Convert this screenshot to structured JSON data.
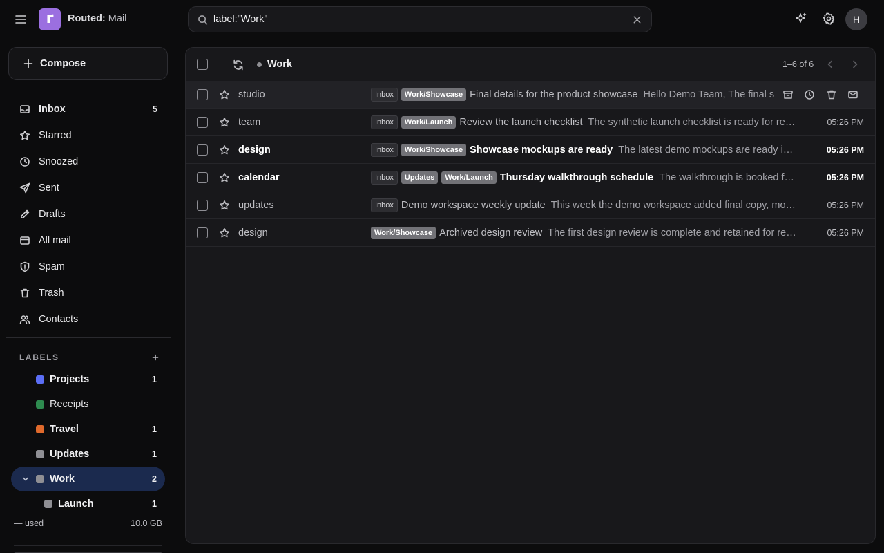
{
  "app": {
    "brand": "Routed:",
    "name": "Mail",
    "logo_letter": "r",
    "accent": "#9b6fe0"
  },
  "search": {
    "value": "label:\"Work\""
  },
  "user": {
    "initial": "H"
  },
  "sidebar": {
    "compose_label": "Compose",
    "nav": [
      {
        "label": "Inbox",
        "count": "5",
        "icon": "inbox-icon",
        "bold": true
      },
      {
        "label": "Starred",
        "count": "",
        "icon": "star-icon"
      },
      {
        "label": "Snoozed",
        "count": "",
        "icon": "clock-icon"
      },
      {
        "label": "Sent",
        "count": "",
        "icon": "send-icon"
      },
      {
        "label": "Drafts",
        "count": "",
        "icon": "pencil-icon"
      },
      {
        "label": "All mail",
        "count": "",
        "icon": "archive-icon"
      },
      {
        "label": "Spam",
        "count": "",
        "icon": "shield-icon"
      },
      {
        "label": "Trash",
        "count": "",
        "icon": "trash-icon"
      },
      {
        "label": "Contacts",
        "count": "",
        "icon": "contacts-icon"
      }
    ],
    "labels_heading": "LABELS",
    "labels": [
      {
        "label": "Projects",
        "count": "1",
        "color": "#5b6ef5"
      },
      {
        "label": "Receipts",
        "count": "",
        "color": "#2e8b4f"
      },
      {
        "label": "Travel",
        "count": "1",
        "color": "#e06a2c"
      },
      {
        "label": "Updates",
        "count": "1",
        "color": "#8f8f94"
      },
      {
        "label": "Work",
        "count": "2",
        "color": "#8f8f94"
      },
      {
        "label": "Launch",
        "count": "1",
        "color": "#8f8f94"
      }
    ],
    "storage": {
      "used": "— used",
      "total": "10.0 GB",
      "fraction": 0
    }
  },
  "toolbar": {
    "folder": "Work",
    "pager": "1–6 of 6"
  },
  "messages": [
    {
      "sender": "studio",
      "chips": [
        "Inbox",
        "Work/Showcase"
      ],
      "subject": "Final details for the product showcase",
      "snippet": "Hello Demo Team, The final show",
      "time": "",
      "unread": false,
      "hover": true
    },
    {
      "sender": "team",
      "chips": [
        "Inbox",
        "Work/Launch"
      ],
      "subject": "Review the launch checklist",
      "snippet": "The synthetic launch checklist is ready for review before the walkthrough.",
      "time": "05:26 PM",
      "unread": false
    },
    {
      "sender": "design",
      "chips": [
        "Inbox",
        "Work/Showcase"
      ],
      "subject": "Showcase mockups are ready",
      "snippet": "The latest demo mockups are ready in the shared folder.",
      "time": "05:26 PM",
      "unread": true
    },
    {
      "sender": "calendar",
      "chips": [
        "Inbox",
        "Updates",
        "Work/Launch"
      ],
      "subject": "Thursday walkthrough schedule",
      "snippet": "The walkthrough is booked for Thursday afternoon.",
      "time": "05:26 PM",
      "unread": true
    },
    {
      "sender": "updates",
      "chips": [
        "Inbox"
      ],
      "subject": "Demo workspace weekly update",
      "snippet": "This week the demo workspace added final copy, mockups and the launch plan.",
      "time": "05:26 PM",
      "unread": false
    },
    {
      "sender": "design",
      "chips": [
        "Work/Showcase"
      ],
      "subject": "Archived design review",
      "snippet": "The first design review is complete and retained for reference.",
      "time": "05:26 PM",
      "unread": false
    }
  ]
}
